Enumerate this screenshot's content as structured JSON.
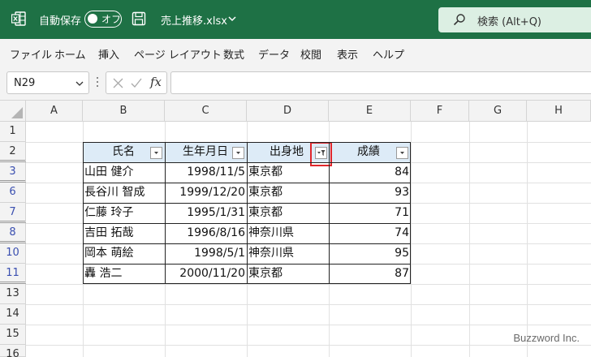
{
  "titlebar": {
    "autosave_label": "自動保存",
    "autosave_state": "オフ",
    "filename": "売上推移.xlsx",
    "search_placeholder": "検索 (Alt+Q)",
    "accent_color": "#1e7145"
  },
  "menu": {
    "items": [
      "ファイル",
      "ホーム",
      "挿入",
      "ページ レイアウト",
      "数式",
      "データ",
      "校閲",
      "表示",
      "ヘルプ"
    ]
  },
  "formula_bar": {
    "name_box": "N29",
    "fx_label": "fx",
    "formula": ""
  },
  "sheet": {
    "columns": [
      "A",
      "B",
      "C",
      "D",
      "E",
      "F",
      "G",
      "H"
    ],
    "rows": [
      "1",
      "2",
      "3",
      "6",
      "7",
      "8",
      "10",
      "11",
      "13",
      "14",
      "15",
      "16"
    ],
    "table": {
      "headers": [
        "氏名",
        "生年月日",
        "出身地",
        "成績"
      ],
      "filtered_column": "出身地",
      "rows": [
        {
          "name": "山田 健介",
          "birth": "1998/11/5",
          "origin": "東京都",
          "score": "84"
        },
        {
          "name": "長谷川 智成",
          "birth": "1999/12/20",
          "origin": "東京都",
          "score": "93"
        },
        {
          "name": "仁藤 玲子",
          "birth": "1995/1/31",
          "origin": "東京都",
          "score": "71"
        },
        {
          "name": "吉田 拓哉",
          "birth": "1996/8/16",
          "origin": "神奈川県",
          "score": "74"
        },
        {
          "name": "岡本 萌絵",
          "birth": "1998/5/1",
          "origin": "神奈川県",
          "score": "95"
        },
        {
          "name": "轟 浩二",
          "birth": "2000/11/20",
          "origin": "東京都",
          "score": "87"
        }
      ],
      "header_fill": "#ddebf7",
      "highlight_color": "#e0262b"
    }
  },
  "watermark": "Buzzword Inc."
}
